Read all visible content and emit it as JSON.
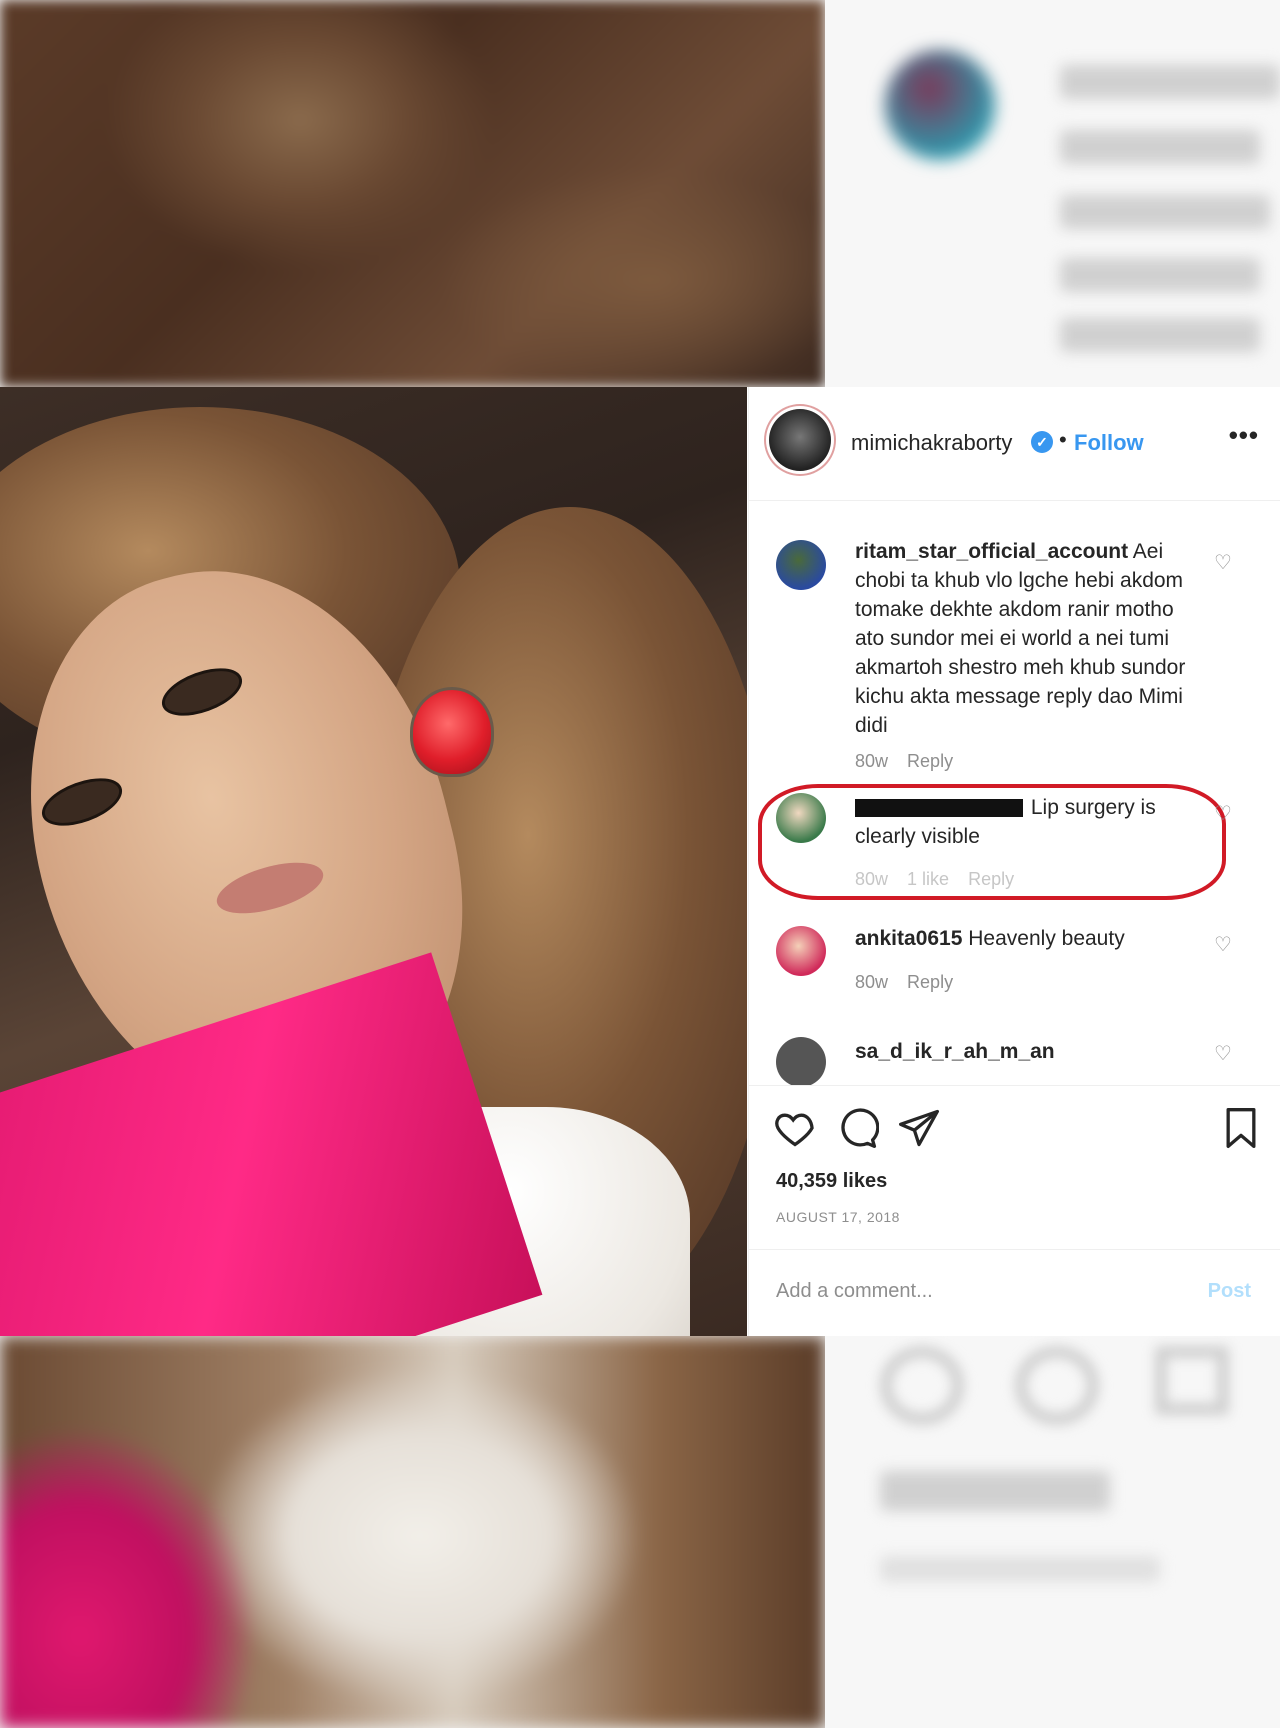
{
  "post": {
    "username": "mimichakraborty",
    "verified_badge": "verified-icon",
    "follow_label": "Follow",
    "separator": "•",
    "more_label": "•••",
    "comments": [
      {
        "user": "ritam_star_official_account",
        "text": "Aei chobi ta khub vlo lgche hebi akdom tomake dekhte akdom ranir motho ato sundor mei ei world a nei tumi akmartoh shestro meh khub sundor kichu akta message reply dao Mimi didi",
        "age": "80w",
        "reply": "Reply"
      },
      {
        "user": "redacted",
        "text": "Lip surgery is clearly visible",
        "age": "80w",
        "likes_label": "1 like",
        "reply": "Reply",
        "highlighted": true
      },
      {
        "user": "ankita0615",
        "text": "Heavenly beauty",
        "age": "80w",
        "reply": "Reply"
      },
      {
        "user": "sa_d_ik_r_ah_m_an",
        "text": ""
      }
    ],
    "likes_text": "40,359 likes",
    "date_text": "AUGUST 17, 2018",
    "add_comment_placeholder": "Add a comment...",
    "post_button_label": "Post"
  },
  "colors": {
    "link_blue": "#3897f0",
    "highlight_red": "#d11a26",
    "post_button_disabled": "#b2dffc"
  }
}
